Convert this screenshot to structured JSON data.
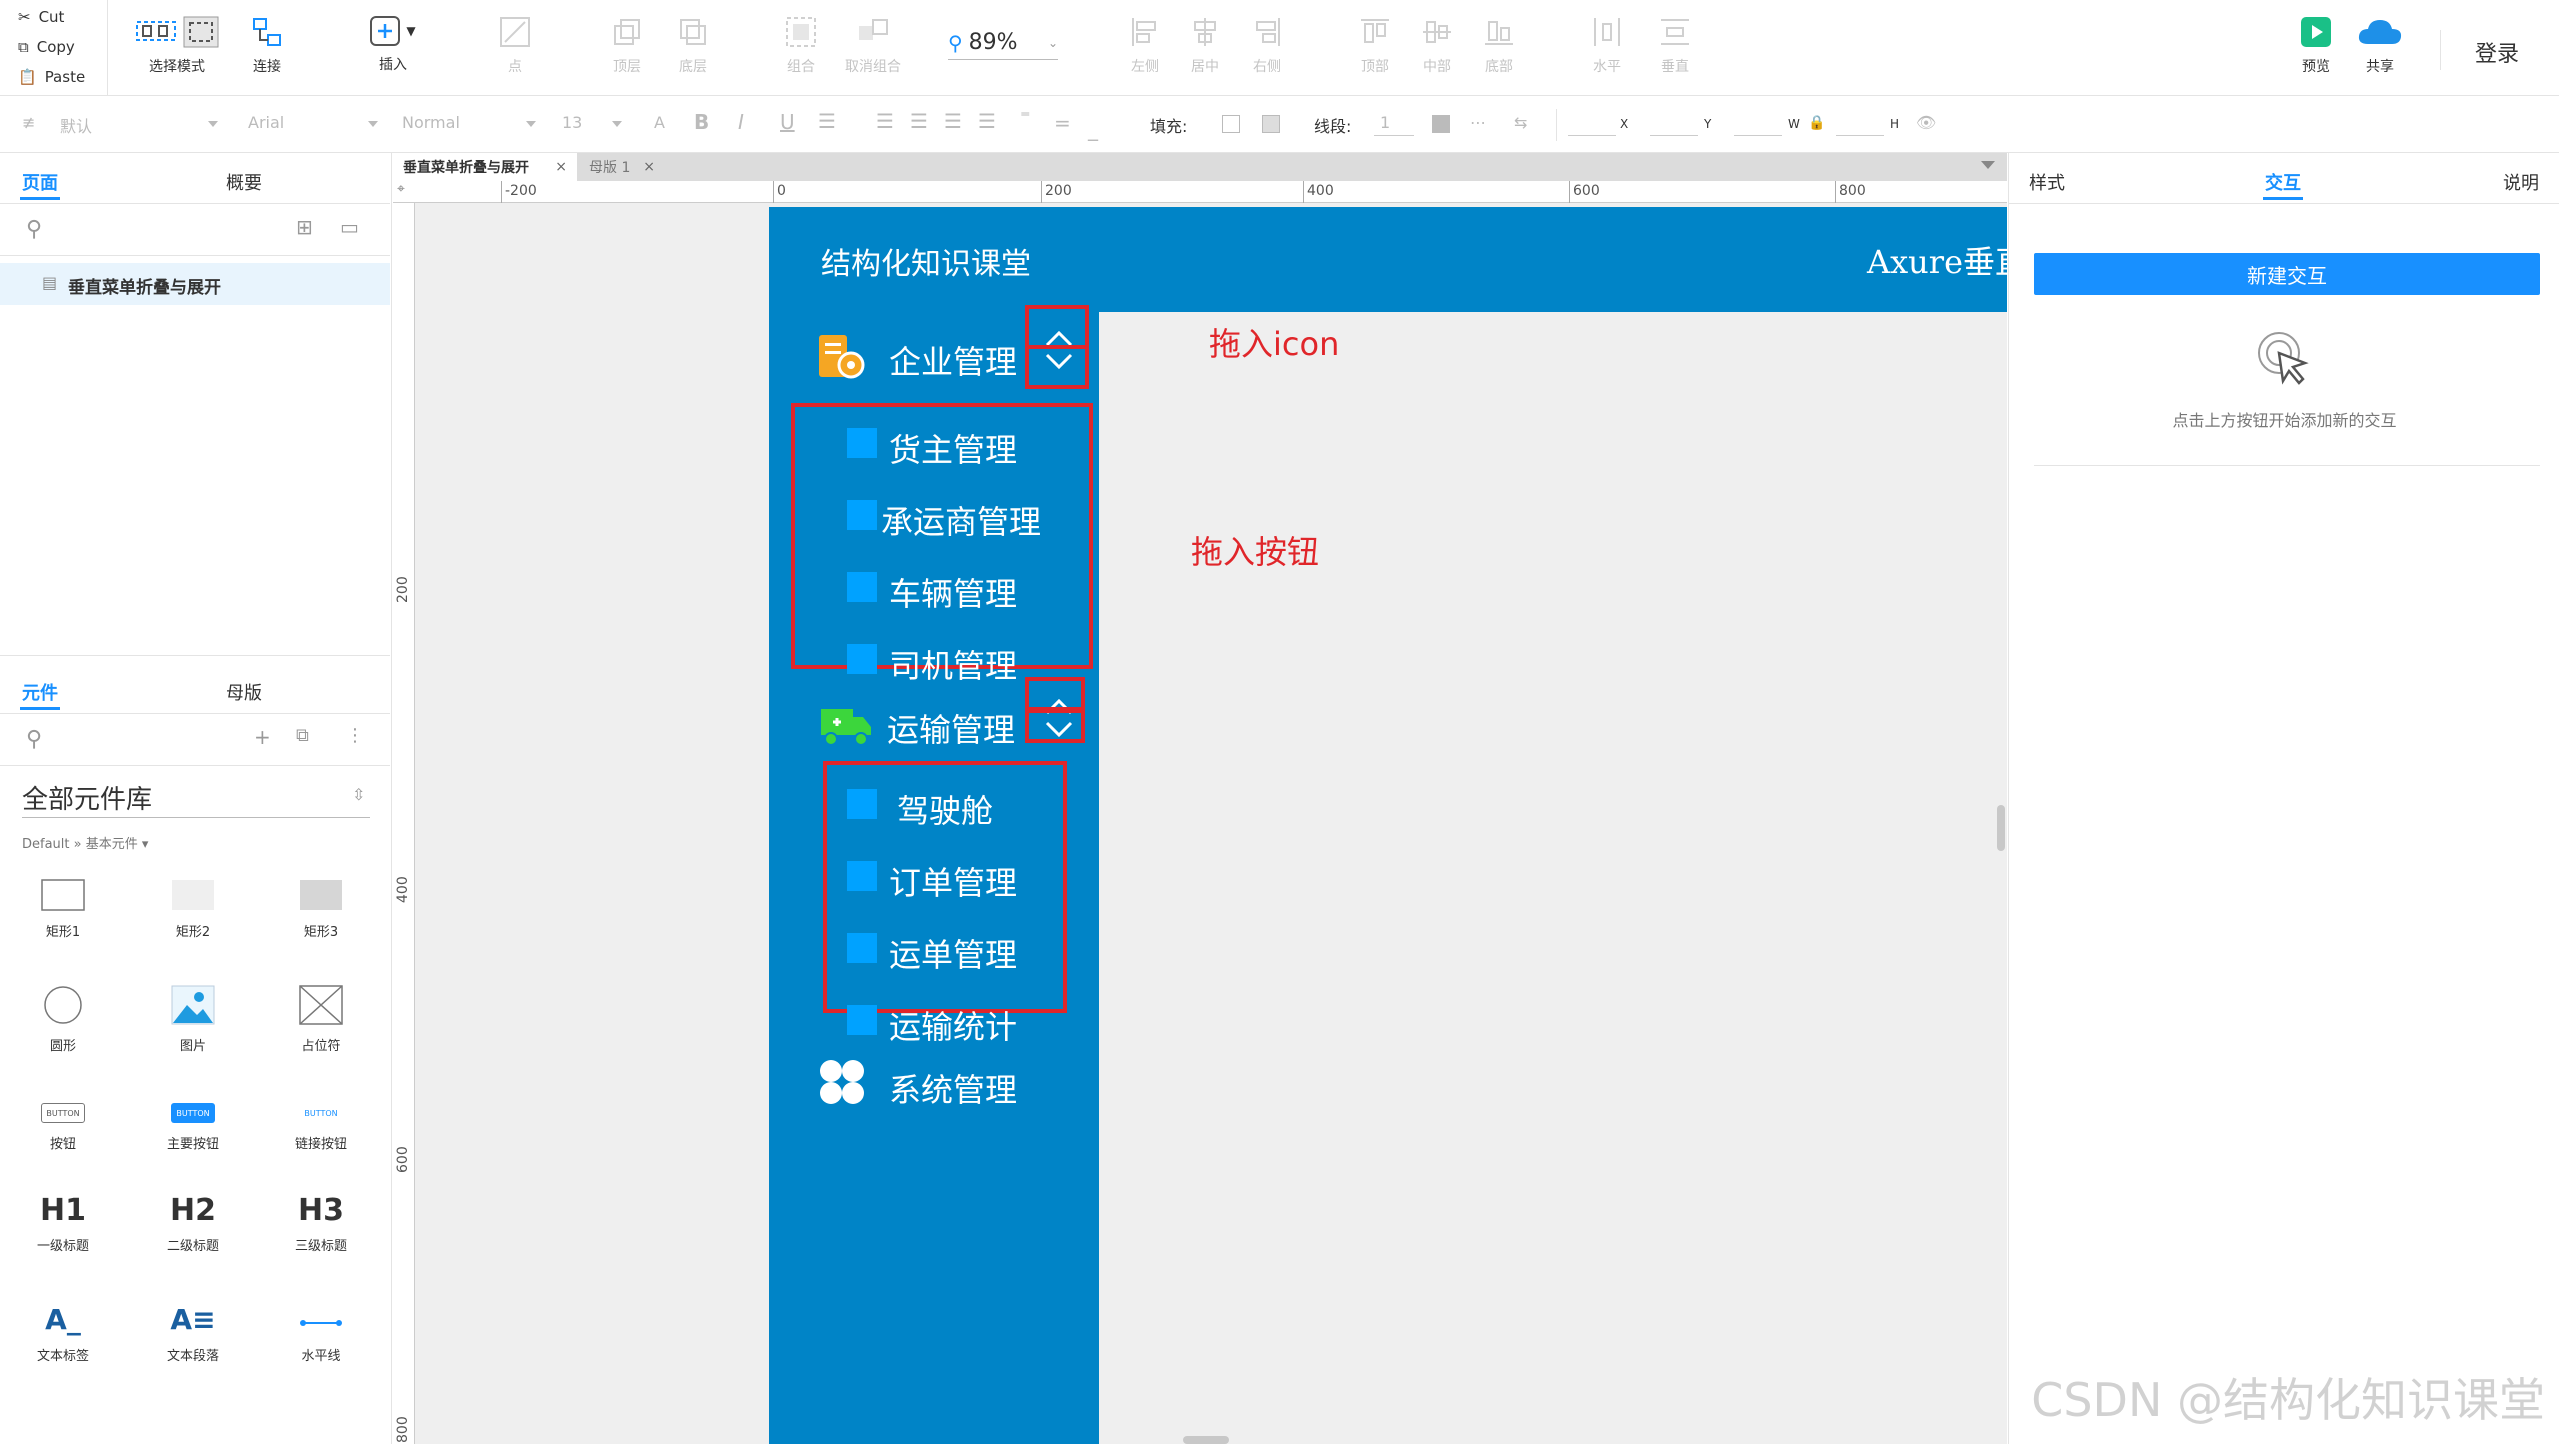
{
  "clipboard": {
    "cut": "Cut",
    "copy": "Copy",
    "paste": "Paste"
  },
  "toolbar": {
    "select_mode": "选择模式",
    "connect": "连接",
    "insert": "插入",
    "point": "点",
    "top_layer": "顶层",
    "bottom_layer": "底层",
    "group": "组合",
    "ungroup": "取消组合",
    "zoom": "89%",
    "align_left": "左侧",
    "align_center": "居中",
    "align_right": "右侧",
    "align_top": "顶部",
    "align_middle": "中部",
    "align_bottom": "底部",
    "distribute_h": "水平",
    "distribute_v": "垂直",
    "preview": "预览",
    "share": "共享",
    "login": "登录"
  },
  "format": {
    "style": "默认",
    "font": "Arial",
    "weight": "Normal",
    "size": "13",
    "fill_label": "填充:",
    "stroke_label": "线段:",
    "stroke_value": "1",
    "x": "X",
    "y": "Y",
    "w": "W",
    "h": "H"
  },
  "left_panel": {
    "tabs": [
      "页面",
      "概要"
    ],
    "page_name": "垂直菜单折叠与展开",
    "lib_tabs": [
      "元件",
      "母版"
    ],
    "library_name": "全部元件库",
    "library_path": "Default » 基本元件 ▾",
    "widgets": [
      "矩形1",
      "矩形2",
      "矩形3",
      "圆形",
      "图片",
      "占位符",
      "按钮",
      "主要按钮",
      "链接按钮",
      "一级标题",
      "二级标题",
      "三级标题",
      "文本标签",
      "文本段落",
      "水平线"
    ],
    "widget_glyphs": {
      "button": "BUTTON",
      "h1": "H1",
      "h2": "H2",
      "h3": "H3",
      "label": "A_",
      "paragraph": "A≡"
    }
  },
  "canvas": {
    "tabs": [
      "垂直菜单折叠与展开",
      "母版 1"
    ],
    "close": "×",
    "ruler_h": [
      "-200",
      "0",
      "200",
      "400",
      "600",
      "800"
    ],
    "ruler_v": [
      "200",
      "400",
      "600",
      "800"
    ]
  },
  "design": {
    "header_title": "结构化知识课堂",
    "header_right": "Axure垂直",
    "menu1": "企业管理",
    "menu1_items": [
      "货主管理",
      "承运商管理",
      "车辆管理",
      "司机管理"
    ],
    "menu2": "运输管理",
    "menu2_items": [
      "驾驶舱",
      "订单管理",
      "运单管理",
      "运输统计"
    ],
    "menu3": "系统管理",
    "annot_icon": "拖入icon",
    "annot_button": "拖入按钮"
  },
  "right_panel": {
    "tabs": [
      "样式",
      "交互",
      "说明"
    ],
    "new_interaction": "新建交互",
    "hint": "点击上方按钮开始添加新的交互"
  },
  "watermark": "CSDN @结构化知识课堂",
  "colors": {
    "accent": "#1890ff",
    "design_blue": "#0084c7",
    "square": "#00a2ff",
    "annotation_red": "#e0262a"
  }
}
